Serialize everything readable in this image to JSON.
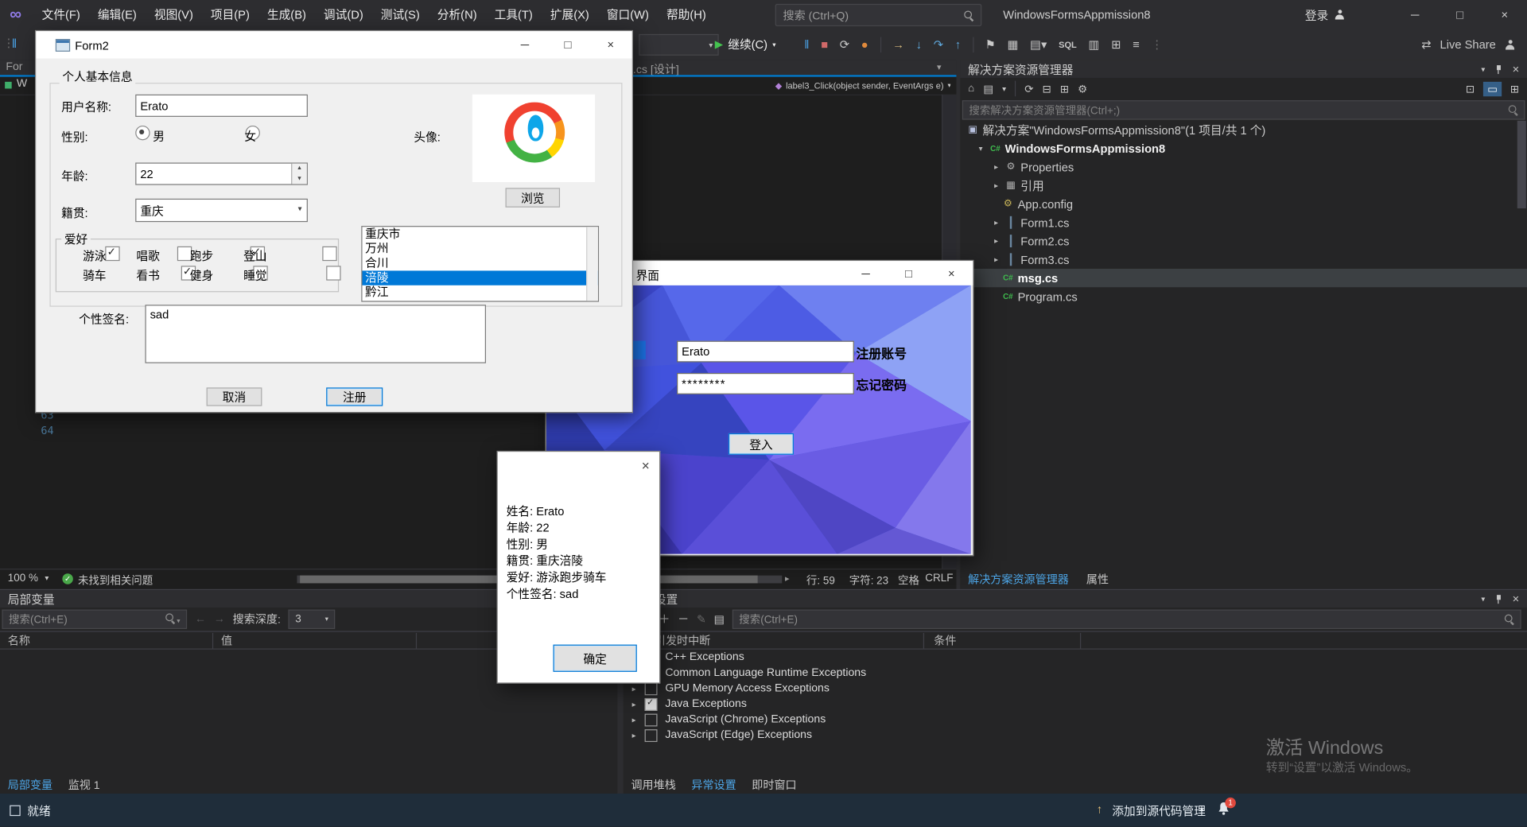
{
  "colors": {
    "accent_blue": "#007acc",
    "selection_blue": "#0078d7",
    "continue_green": "#3ac14a",
    "scrollmap_green": "#3fa45f",
    "notification_red": "#e0493e",
    "titlebar_bg": "#2d2d30",
    "editor_bg": "#1e1e1e",
    "panel_bg": "#252526",
    "statusbar_bg": "#1f2d3a"
  },
  "titlebar": {
    "menus": [
      "文件(F)",
      "编辑(E)",
      "视图(V)",
      "项目(P)",
      "生成(B)",
      "调试(D)",
      "测试(S)",
      "分析(N)",
      "工具(T)",
      "扩展(X)",
      "窗口(W)",
      "帮助(H)"
    ],
    "search_placeholder": "搜索 (Ctrl+Q)",
    "app_title": "WindowsFormsAppmission8",
    "sign_in": "登录"
  },
  "toolbar": {
    "continue_label": "继续(C)",
    "sql_label": "SQL",
    "live_share_label": "Live Share"
  },
  "editor": {
    "tab_left_fragment": "For",
    "tab_fragment": ".cs [设计]",
    "breadcrumb_left": "W",
    "method_signature": "label3_Click(object sender, EventArgs e)",
    "line_63": "63",
    "line_64": "64",
    "zoom": "100 %",
    "health_message": "未找到相关问题",
    "line_indicator": "行: 59",
    "char_indicator": "字符: 23",
    "space_indicator": "空格",
    "eol_indicator": "CRLF"
  },
  "solution_explorer": {
    "title": "解决方案资源管理器",
    "search_placeholder": "搜索解决方案资源管理器(Ctrl+;)",
    "tree": [
      {
        "label": "解决方案\"WindowsFormsAppmission8\"(1 项目/共 1 个)",
        "selected": false
      },
      {
        "label": "WindowsFormsAppmission8",
        "selected": false
      },
      {
        "label": "Properties",
        "selected": false
      },
      {
        "label": "引用",
        "selected": false
      },
      {
        "label": "App.config",
        "selected": false
      },
      {
        "label": "Form1.cs",
        "selected": false
      },
      {
        "label": "Form2.cs",
        "selected": false
      },
      {
        "label": "Form3.cs",
        "selected": false
      },
      {
        "label": "msg.cs",
        "selected": true
      },
      {
        "label": "Program.cs",
        "selected": false
      }
    ],
    "tabs": [
      "解决方案资源管理器",
      "属性"
    ]
  },
  "locals_panel": {
    "title": "局部变量",
    "search_placeholder": "搜索(Ctrl+E)",
    "depth_label": "搜索深度:",
    "depth_value": "3",
    "columns": [
      "名称",
      "值"
    ],
    "tabs": [
      "局部变量",
      "监视 1"
    ]
  },
  "exceptions_panel": {
    "title": "异常设置",
    "search_placeholder": "搜索(Ctrl+E)",
    "break_column": "引发时中断",
    "condition_column": "条件",
    "rows": [
      {
        "label": "C++ Exceptions",
        "checked": true
      },
      {
        "label": "Common Language Runtime Exceptions",
        "checked": true
      },
      {
        "label": "GPU Memory Access Exceptions",
        "checked": false
      },
      {
        "label": "Java Exceptions",
        "checked": true
      },
      {
        "label": "JavaScript (Chrome) Exceptions",
        "checked": false
      },
      {
        "label": "JavaScript (Edge) Exceptions",
        "checked": false
      }
    ],
    "tabs": [
      "调用堆栈",
      "异常设置",
      "即时窗口"
    ]
  },
  "statusbar": {
    "ready": "就绪",
    "source_control": "添加到源代码管理",
    "notification_count": "1"
  },
  "watermark": {
    "line1": "激活 Windows",
    "line2": "转到“设置”以激活 Windows。"
  },
  "form2": {
    "window_title": "Form2",
    "group_title": "个人基本信息",
    "username_label": "用户名称:",
    "username_value": "Erato",
    "gender_label": "性别:",
    "gender_male": "男",
    "gender_male_selected": true,
    "gender_female": "女",
    "gender_female_selected": false,
    "avatar_label": "头像:",
    "browse_button": "浏览",
    "age_label": "年龄:",
    "age_value": "22",
    "hometown_label": "籍贯:",
    "hometown_value": "重庆",
    "hobby_group_title": "爱好",
    "hobbies": [
      {
        "label": "游泳",
        "checked": true
      },
      {
        "label": "唱歌",
        "checked": false
      },
      {
        "label": "跑步",
        "checked": true
      },
      {
        "label": "登山",
        "checked": false
      },
      {
        "label": "骑车",
        "checked": true
      },
      {
        "label": "看书",
        "checked": false
      },
      {
        "label": "健身",
        "checked": false
      },
      {
        "label": "睡觉",
        "checked": false
      }
    ],
    "city_list": [
      {
        "label": "重庆市",
        "selected": false
      },
      {
        "label": "万州",
        "selected": false
      },
      {
        "label": "合川",
        "selected": false
      },
      {
        "label": "涪陵",
        "selected": true
      },
      {
        "label": "黔江",
        "selected": false
      }
    ],
    "signature_label": "个性签名:",
    "signature_value": "sad",
    "cancel_button": "取消",
    "register_button": "注册"
  },
  "login_window": {
    "title_fragment": "界面",
    "username_value": "Erato",
    "password_value": "********",
    "register_link": "注册账号",
    "forgot_link": "忘记密码",
    "login_button": "登入"
  },
  "message_box": {
    "lines": [
      "姓名: Erato",
      "年龄: 22",
      "性别: 男",
      "籍贯: 重庆涪陵",
      "爱好: 游泳跑步骑车",
      "个性签名: sad"
    ],
    "ok_button": "确定"
  }
}
